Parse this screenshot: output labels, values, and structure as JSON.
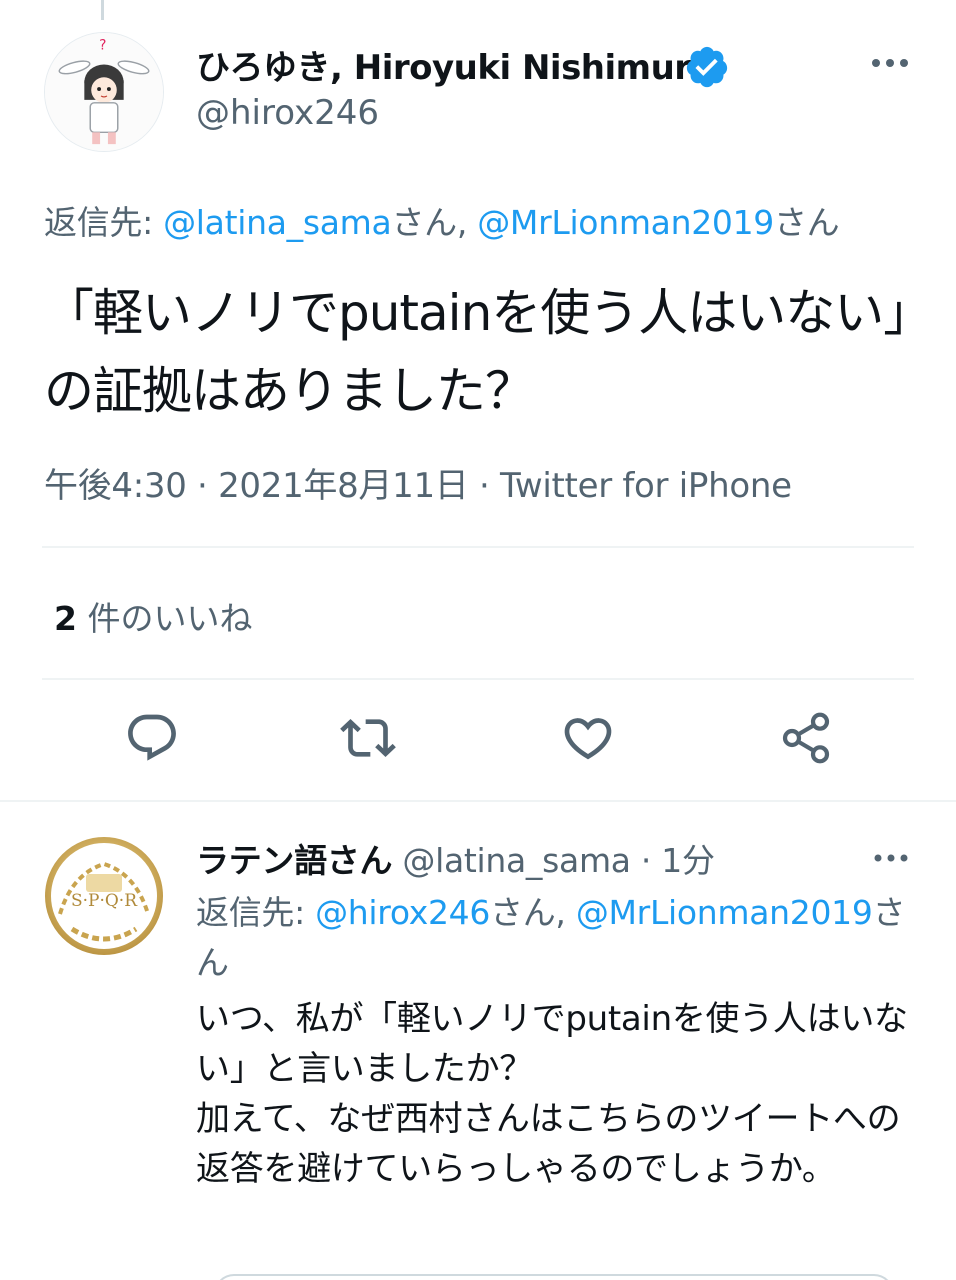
{
  "main_tweet": {
    "display_name": "ひろゆき, Hiroyuki Nishimura",
    "handle": "@hirox246",
    "reply_to": {
      "prefix": "返信先: ",
      "mention1": "@latina_sama",
      "suffix1": "さん, ",
      "mention2": "@MrLionman2019",
      "suffix2": "さん"
    },
    "text": "「軽いノリでputainを使う人はいない」の証拠はありました？",
    "meta": "午後4:30 · 2021年8月11日 · Twitter for iPhone",
    "likes_count": "2",
    "likes_label": " 件のいいね"
  },
  "reply_tweet": {
    "display_name": "ラテン語さん",
    "handle_time": " @latina_sama · 1分",
    "reply_to": {
      "prefix": "返信先: ",
      "mention1": "@hirox246",
      "suffix1": "さん, ",
      "mention2": "@MrLionman2019",
      "suffix2": "さん"
    },
    "text_line1": "いつ、私が「軽いノリでputainを使う人はいない」と言いましたか？",
    "text_line2": "加えて、なぜ西村さんはこちらのツイートへの返答を避けていらっしゃるのでしょうか。",
    "avatar_text": "S·P·Q·R"
  },
  "colors": {
    "link": "#1d9bf0",
    "secondary_text": "#536471",
    "primary_text": "#0f1419",
    "verified": "#1d9bf0"
  },
  "icons": {
    "verified": "verified-badge-icon",
    "more": "more-horizontal-icon",
    "reply": "reply-icon",
    "retweet": "retweet-icon",
    "like": "heart-icon",
    "share": "share-icon"
  }
}
